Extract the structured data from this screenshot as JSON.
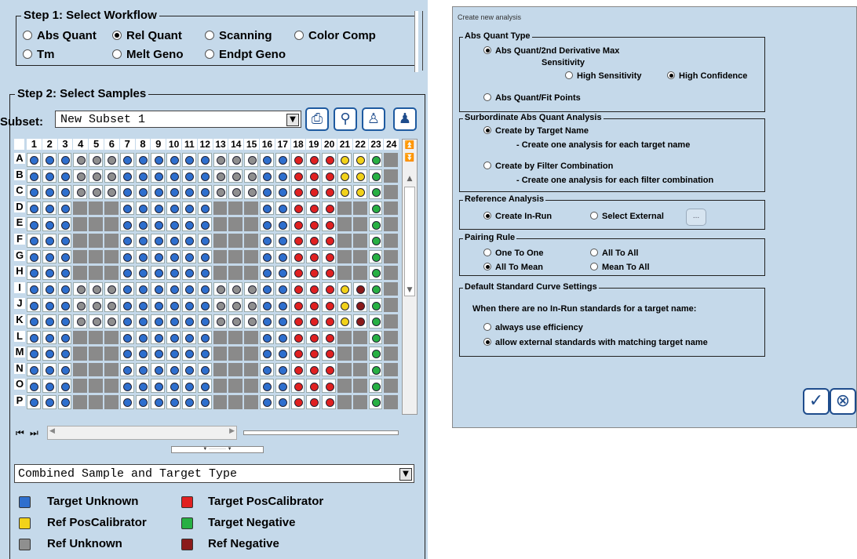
{
  "step1": {
    "title": "Step 1: Select Workflow",
    "options": [
      {
        "label": "Abs Quant",
        "selected": false
      },
      {
        "label": "Rel Quant",
        "selected": true
      },
      {
        "label": "Scanning",
        "selected": false
      },
      {
        "label": "Color Comp",
        "selected": false
      },
      {
        "label": "Tm",
        "selected": false
      },
      {
        "label": "Melt Geno",
        "selected": false
      },
      {
        "label": "Endpt Geno",
        "selected": false
      }
    ]
  },
  "step2": {
    "title": "Step 2: Select Samples",
    "subset_label": "Subset:",
    "subset_value": "New Subset 1",
    "toolbar_icons": [
      "plate-icon",
      "zoom-icon",
      "add-person-icon",
      "remove-person-icon"
    ]
  },
  "plate": {
    "columns": [
      "1",
      "2",
      "3",
      "4",
      "5",
      "6",
      "7",
      "8",
      "9",
      "10",
      "11",
      "12",
      "13",
      "14",
      "15",
      "16",
      "17",
      "18",
      "19",
      "20",
      "21",
      "22",
      "23",
      "24"
    ],
    "rows": [
      "A",
      "B",
      "C",
      "D",
      "E",
      "F",
      "G",
      "H",
      "I",
      "J",
      "K",
      "L",
      "M",
      "N",
      "O",
      "P"
    ],
    "colors": {
      "b": "#2e6fce",
      "g": "#8f8f8f",
      "r": "#e02020",
      "y": "#f2d21a",
      "n": "#27b043",
      "d": "#8b1a1a",
      "x": "#8a8a8a"
    },
    "cells": [
      "bbbgggbbbbbbgggbbrrryyn",
      "bbbgggbbbbbbgggbbrrryyn",
      "bbbgggbbbbbbgggbbrrryyn",
      "bbbxxxbbbbbbxxxbbrrrxxn",
      "bbbxxxbbbbbbxxxbbrrrxxn",
      "bbbxxxbbbbbbxxxbbrrrxxn",
      "bbbxxxbbbbbbxxxbbrrrxxn",
      "bbbxxxbbbbbbxxxbbrrrxxn",
      "bbbgggbbbbbbgggbbrrrydn",
      "bbbgggbbbbbbgggbbrrrydn",
      "bbbgggbbbbbbgggbbrrrydn",
      "bbbxxxbbbbbbxxxbbrrrxxn",
      "bbbxxxbbbbbbxxxbbrrrxxn",
      "bbbxxxbbbbbbxxxbbrrrxxn",
      "bbbxxxbbbbbbxxxbbrrrxxn",
      "bbbxxxbbbbbbxxxbbrrrxxn"
    ]
  },
  "color_by": "Combined Sample and Target Type",
  "legend": [
    {
      "label": "Target Unknown",
      "color": "#2e6fce"
    },
    {
      "label": "Target PosCalibrator",
      "color": "#e02020"
    },
    {
      "label": "Ref PosCalibrator",
      "color": "#f2d21a"
    },
    {
      "label": "Target Negative",
      "color": "#27b043"
    },
    {
      "label": "Ref Unknown",
      "color": "#8f8f8f"
    },
    {
      "label": "Ref Negative",
      "color": "#8b1a1a"
    }
  ],
  "dialog": {
    "title": "Create new analysis",
    "abs_quant_type": {
      "title": "Abs Quant Type",
      "opt1_line1": "Abs Quant/2nd Derivative Max",
      "opt1_line2": "Sensitivity",
      "high_sensitivity": "High Sensitivity",
      "high_confidence": "High Confidence",
      "opt2": "Abs Quant/Fit Points"
    },
    "surrogate": {
      "title": "Surbordinate Abs Quant Analysis",
      "by_target": "Create by Target Name",
      "by_target_desc": "- Create one analysis for each target name",
      "by_filter": "Create by Filter Combination",
      "by_filter_desc": "- Create one analysis for each filter combination"
    },
    "reference": {
      "title": "Reference Analysis",
      "in_run": "Create In-Run",
      "external": "Select External",
      "browse": "..."
    },
    "pairing": {
      "title": "Pairing Rule",
      "one_to_one": "One To One",
      "all_to_all": "All To All",
      "all_to_mean": "All To Mean",
      "mean_to_all": "Mean To All"
    },
    "std_curve": {
      "title": "Default Standard Curve Settings",
      "prompt": "When there are no In-Run standards for a target name:",
      "opt1": "always use efficiency",
      "opt2": "allow external standards with matching target name"
    },
    "ok_icon": "check-icon",
    "cancel_icon": "cancel-icon"
  }
}
